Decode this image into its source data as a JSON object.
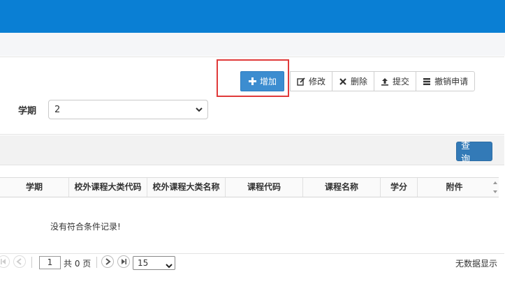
{
  "toolbar": {
    "add": "增加",
    "edit": "修改",
    "delete": "删除",
    "submit": "提交",
    "revoke": "撤销申请"
  },
  "filters": {
    "term_label": "学期",
    "term_value": "2"
  },
  "search": {
    "query_label": "查 询"
  },
  "table": {
    "columns": [
      "学期",
      "校外课程大类代码",
      "校外课程大类名称",
      "课程代码",
      "课程名称",
      "学分",
      "附件"
    ],
    "empty_message": "没有符合条件记录!"
  },
  "pager": {
    "page_input": "1",
    "total_pages": "共 0 页",
    "page_size": "15",
    "status": "无数据显示"
  },
  "colors": {
    "topbar": "#0a7fd4",
    "primary": "#3c8dd0",
    "highlight": "#e03a3a"
  },
  "icons": {
    "add": "plus-icon",
    "edit": "edit-icon",
    "delete": "x-icon",
    "submit": "upload-icon",
    "revoke": "list-icon"
  }
}
